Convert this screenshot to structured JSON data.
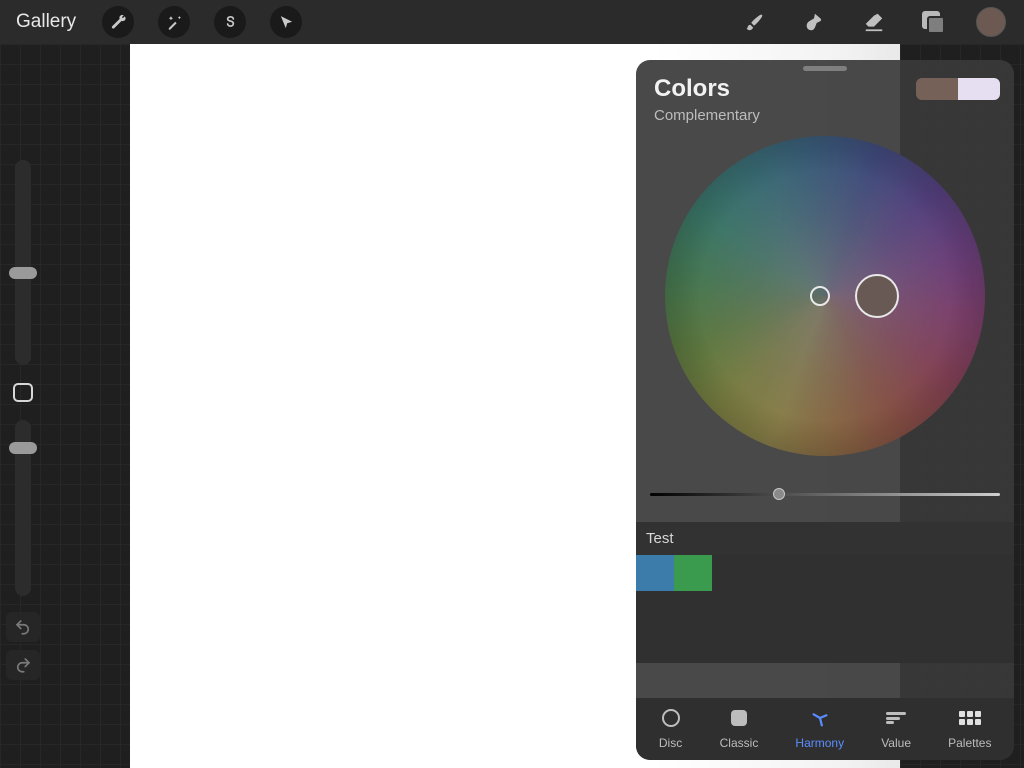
{
  "header": {
    "gallery_label": "Gallery"
  },
  "sidebar": {
    "brush_slider_pos_pct": 52,
    "opacity_slider_pos_pct": 12
  },
  "color_panel": {
    "title": "Colors",
    "mode_label": "Complementary",
    "primary_swatch": "#766158",
    "secondary_swatch": "#e6def1",
    "current_color": "#6b5952",
    "value_slider_pct": 35,
    "palette_name": "Test",
    "palette_colors": [
      "#3b7cab",
      "#3a9b4f"
    ],
    "tabs": [
      {
        "id": "disc",
        "label": "Disc"
      },
      {
        "id": "classic",
        "label": "Classic"
      },
      {
        "id": "harmony",
        "label": "Harmony"
      },
      {
        "id": "value",
        "label": "Value"
      },
      {
        "id": "palettes",
        "label": "Palettes"
      }
    ],
    "active_tab": "harmony"
  }
}
